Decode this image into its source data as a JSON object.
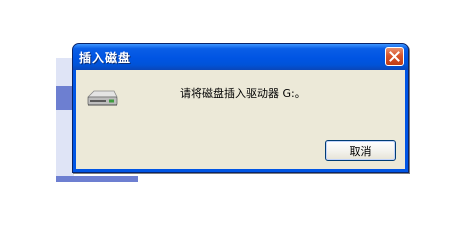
{
  "dialog": {
    "title": "插入磁盘",
    "message": "请将磁盘插入驱动器 G:。",
    "cancel_label": "取消",
    "icons": {
      "close": "close-icon",
      "drive": "disk-drive-icon"
    }
  },
  "colors": {
    "titlebar": "#0054e3",
    "dialog_body": "#ece9d8",
    "close_button": "#d8542b",
    "button_border": "#003c74",
    "background_accent": "#6d7fd1"
  }
}
